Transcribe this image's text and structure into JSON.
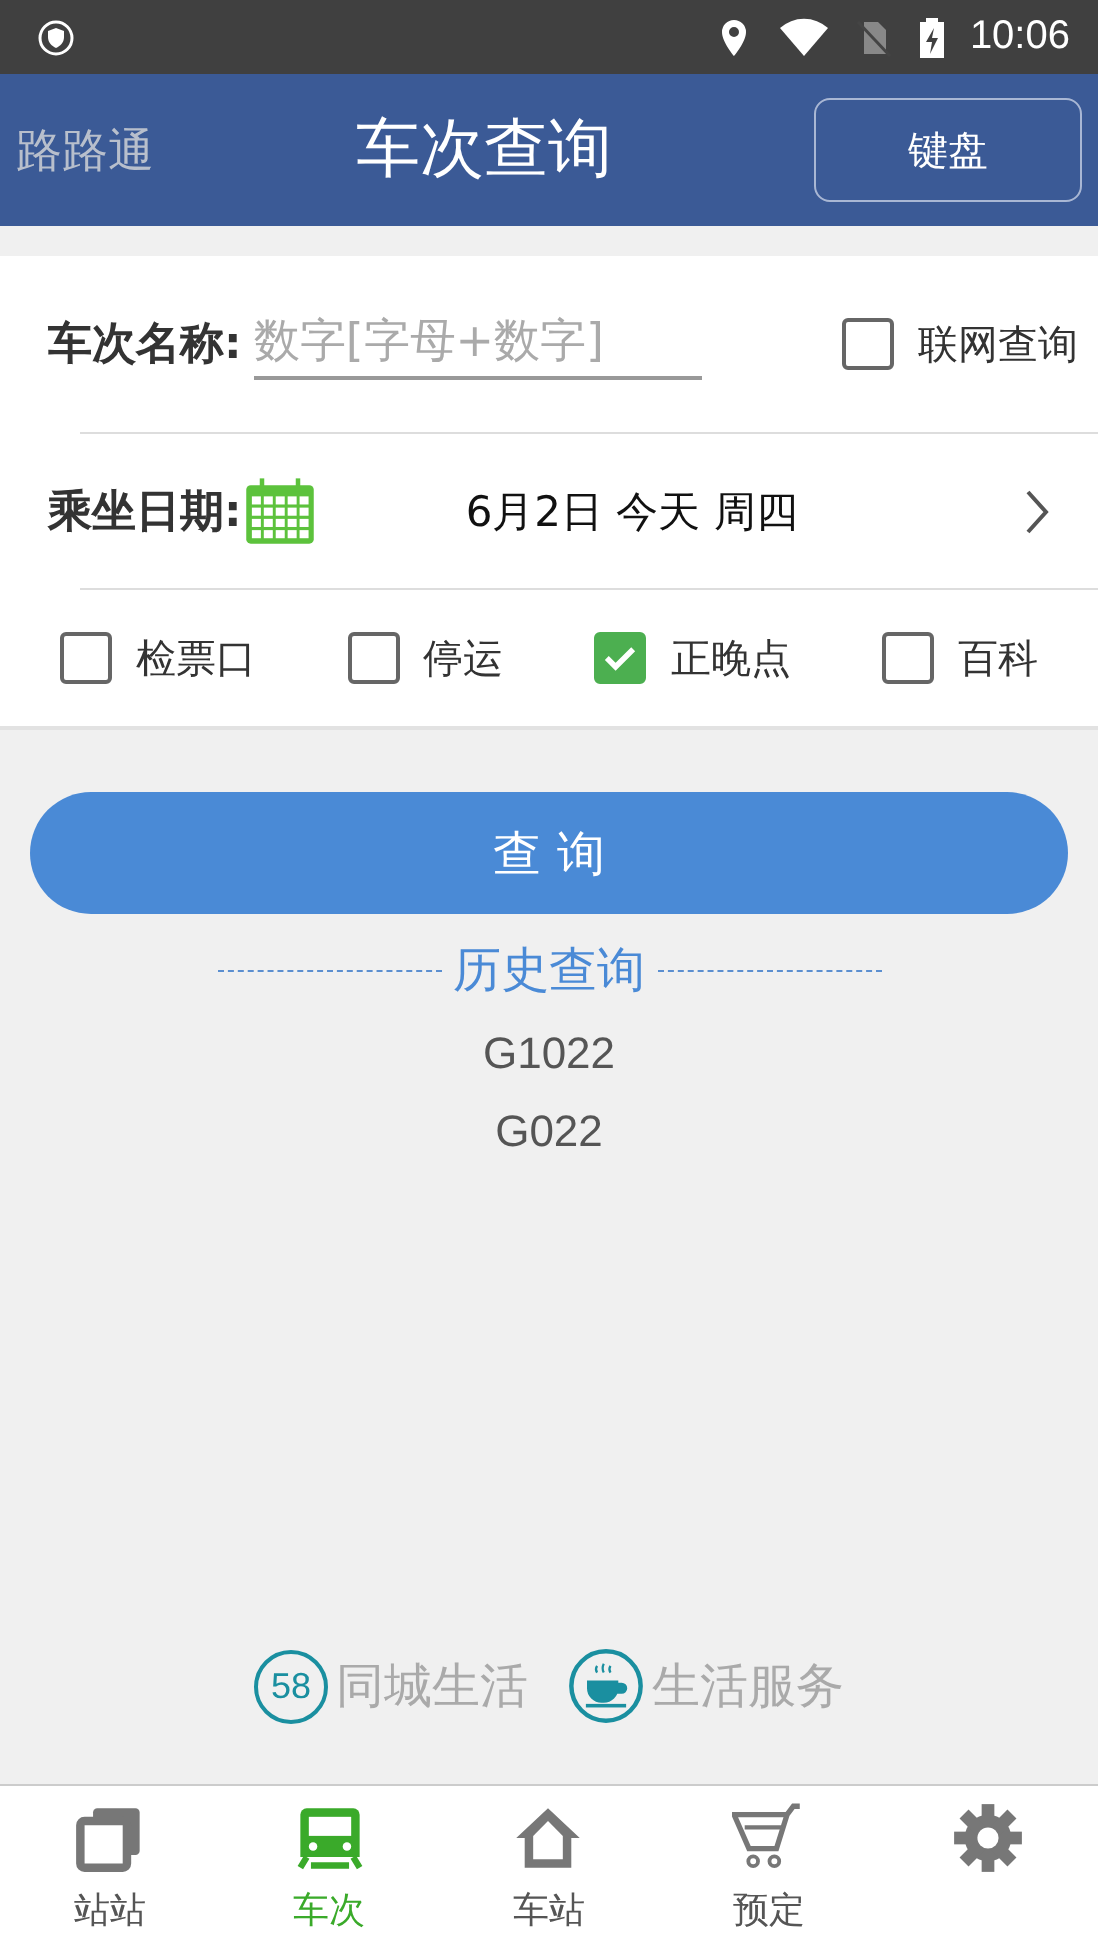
{
  "status_bar": {
    "time": "10:06"
  },
  "header": {
    "app_name": "路路通",
    "title": "车次查询",
    "button": "键盘"
  },
  "form": {
    "name_label": "车次名称:",
    "name_placeholder": "数字[字母+数字]",
    "online": {
      "label": "联网查询",
      "checked": false
    },
    "date_label": "乘坐日期:",
    "date_value": "6月2日 今天 周四",
    "options": [
      {
        "label": "检票口",
        "checked": false
      },
      {
        "label": "停运",
        "checked": false
      },
      {
        "label": "正晚点",
        "checked": true
      },
      {
        "label": "百科",
        "checked": false
      }
    ]
  },
  "query_button": "查 询",
  "history": {
    "title": "历史查询",
    "items": [
      "G1022",
      "G022"
    ]
  },
  "services": [
    {
      "kind": "badge",
      "badge": "58",
      "label": "同城生活"
    },
    {
      "kind": "cup",
      "label": "生活服务"
    }
  ],
  "tabs": [
    {
      "kind": "windows",
      "label": "站站",
      "selected": false
    },
    {
      "kind": "train",
      "label": "车次",
      "selected": true
    },
    {
      "kind": "house",
      "label": "车站",
      "selected": false
    },
    {
      "kind": "cart",
      "label": "预定",
      "selected": false
    },
    {
      "kind": "gear",
      "selected": false
    }
  ]
}
